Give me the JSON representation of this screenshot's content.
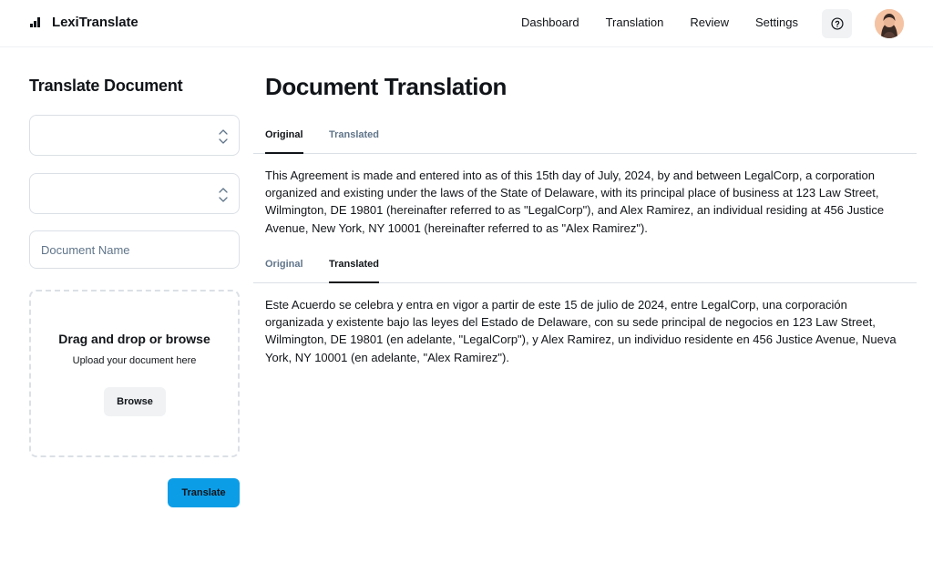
{
  "header": {
    "brand": "LexiTranslate",
    "nav": [
      "Dashboard",
      "Translation",
      "Review",
      "Settings"
    ]
  },
  "left": {
    "title": "Translate Document",
    "source_select": "",
    "target_select": "",
    "doc_name_placeholder": "Document Name",
    "dropzone_title": "Drag and drop or browse",
    "dropzone_sub": "Upload your document here",
    "browse_label": "Browse",
    "translate_label": "Translate"
  },
  "main": {
    "title": "Document Translation",
    "tabs1": [
      "Original",
      "Translated"
    ],
    "tabs2": [
      "Original",
      "Translated"
    ],
    "original_text": "This Agreement is made and entered into as of this 15th day of July, 2024, by and between LegalCorp, a corporation organized and existing under the laws of the State of Delaware, with its principal place of business at 123 Law Street, Wilmington, DE 19801 (hereinafter referred to as \"LegalCorp\"), and Alex Ramirez, an individual residing at 456 Justice Avenue, New York, NY 10001 (hereinafter referred to as \"Alex Ramirez\").",
    "translated_text": "Este Acuerdo se celebra y entra en vigor a partir de este 15 de julio de 2024, entre LegalCorp, una corporación organizada y existente bajo las leyes del Estado de Delaware, con su sede principal de negocios en 123 Law Street, Wilmington, DE 19801 (en adelante, \"LegalCorp\"), y Alex Ramirez, un individuo residente en 456 Justice Avenue, Nueva York, NY 10001 (en adelante, \"Alex Ramirez\")."
  },
  "colors": {
    "accent": "#0c9de7",
    "muted": "#60758a",
    "border": "#dbe0e6",
    "button_bg": "#f0f2f4"
  }
}
